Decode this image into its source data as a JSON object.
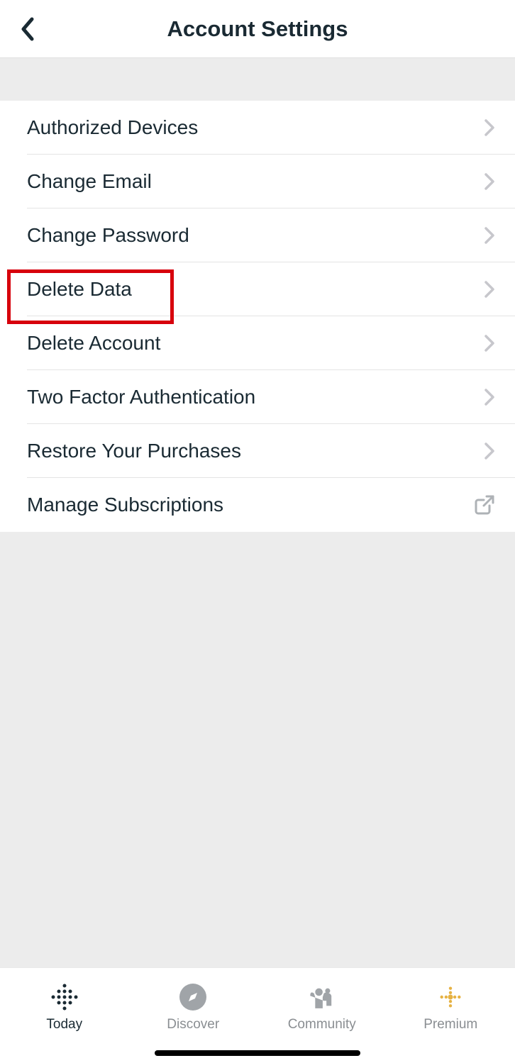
{
  "header": {
    "title": "Account Settings"
  },
  "settings": {
    "items": [
      {
        "label": "Authorized Devices",
        "icon": "chevron"
      },
      {
        "label": "Change Email",
        "icon": "chevron"
      },
      {
        "label": "Change Password",
        "icon": "chevron"
      },
      {
        "label": "Delete Data",
        "icon": "chevron"
      },
      {
        "label": "Delete Account",
        "icon": "chevron"
      },
      {
        "label": "Two Factor Authentication",
        "icon": "chevron"
      },
      {
        "label": "Restore Your Purchases",
        "icon": "chevron"
      },
      {
        "label": "Manage Subscriptions",
        "icon": "external"
      }
    ]
  },
  "tabs": {
    "items": [
      {
        "label": "Today",
        "active": true
      },
      {
        "label": "Discover",
        "active": false
      },
      {
        "label": "Community",
        "active": false
      },
      {
        "label": "Premium",
        "active": false
      }
    ]
  },
  "highlight": {
    "target": "Delete Data"
  }
}
